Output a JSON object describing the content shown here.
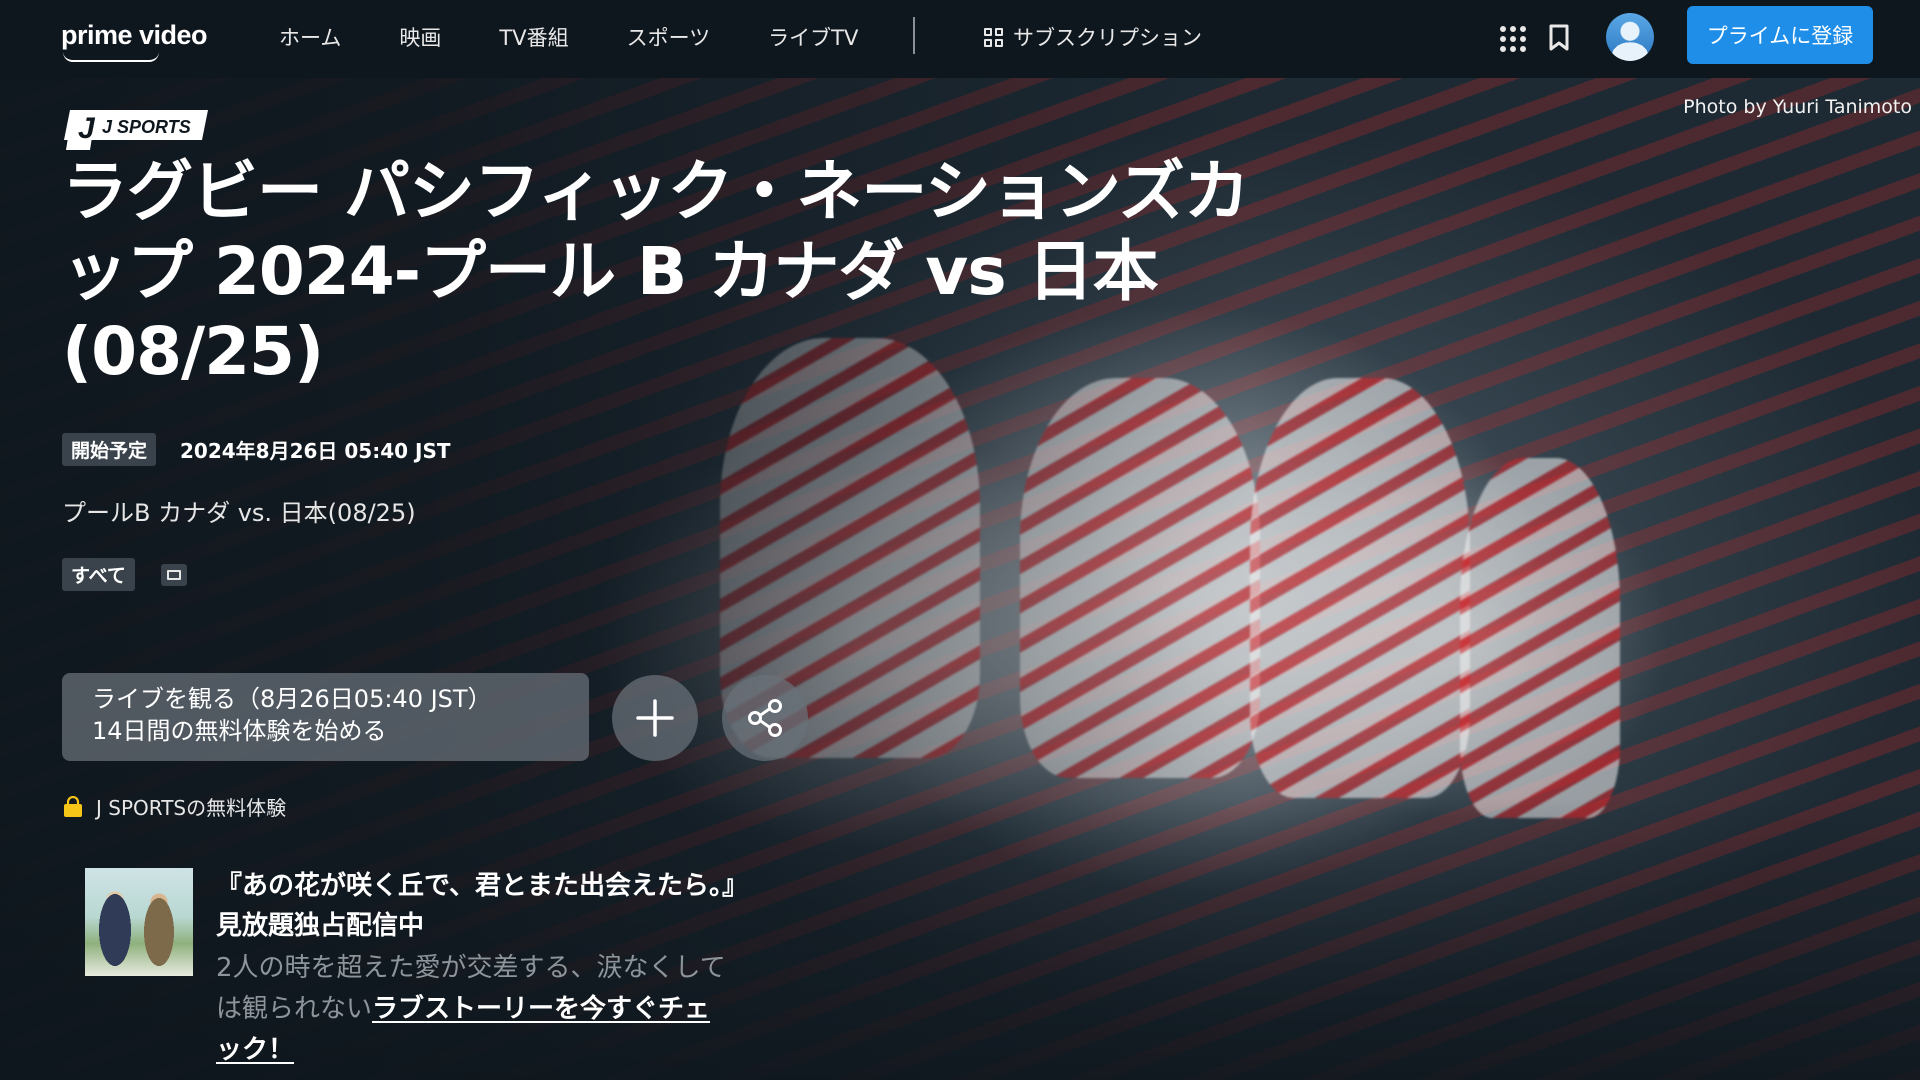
{
  "nav": {
    "logo": "prime video",
    "items": [
      "ホーム",
      "映画",
      "TV番組",
      "スポーツ",
      "ライブTV"
    ],
    "subscriptions": "サブスクリプション",
    "signup": "プライムに登録"
  },
  "hero": {
    "photo_credit": "Photo by Yuuri Tanimoto",
    "channel_logo": "J SPORTS",
    "title": "ラグビー パシフィック・ネーションズカップ 2024-プール B カナダ vs 日本 (08/25)",
    "status_badge": "開始予定",
    "start_date": "2024年8月26日 05:40 JST",
    "subtitle": "プールB カナダ vs. 日本(08/25)",
    "rating_tag": "すべて",
    "watch_button": {
      "line1": "ライブを観る（8月26日05:40 JST）",
      "line2": "14日間の無料体験を始める"
    },
    "trial_text": "J SPORTSの無料体験"
  },
  "promo": {
    "title": "『あの花が咲く丘で、君とまた出会えたら。』見放題独占配信中",
    "desc": "2人の時を超えた愛が交差する、涙なくしては観られない",
    "link": "ラブストーリーを今すぐチェック！"
  },
  "colors": {
    "background": "#0f171e",
    "accent": "#1e8ee8",
    "badge": "#3a434b"
  }
}
